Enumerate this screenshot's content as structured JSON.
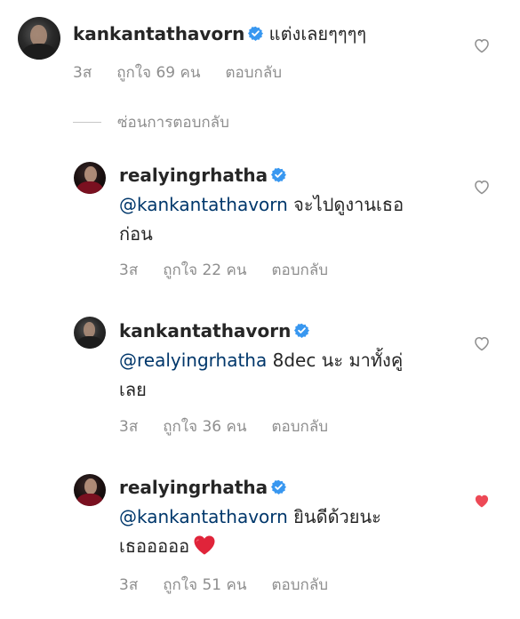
{
  "comments": [
    {
      "username": "kankantathavorn",
      "text": "แต่งเลยๆๆๆๆ",
      "time": "3ส",
      "likes": "ถูกใจ 69 คน",
      "reply": "ตอบกลับ",
      "liked": false
    },
    {
      "username": "realyingrhatha",
      "mention": "@kankantathavorn",
      "text_line1": " จะไปดูงานเธอ",
      "text_line2": "ก่อน",
      "time": "3ส",
      "likes": "ถูกใจ 22 คน",
      "reply": "ตอบกลับ",
      "liked": false
    },
    {
      "username": "kankantathavorn",
      "mention": "@realyingrhatha",
      "text_line1": " 8dec นะ มาทั้งคู่",
      "text_line2": "เลย",
      "time": "3ส",
      "likes": "ถูกใจ 36 คน",
      "reply": "ตอบกลับ",
      "liked": false
    },
    {
      "username": "realyingrhatha",
      "mention": "@kankantathavorn",
      "text_line1": " ยินดีด้วยนะ",
      "text_line2": "เธอออออ",
      "time": "3ส",
      "likes": "ถูกใจ 51 คน",
      "reply": "ตอบกลับ",
      "liked": true
    }
  ],
  "hide_replies": "ซ่อนการตอบกลับ",
  "colors": {
    "text": "#262626",
    "meta": "#8e8e8e",
    "mention": "#00376b",
    "verified": "#3897f0",
    "liked_heart": "#ed4956"
  },
  "icons": {
    "verified": "verified-badge-icon",
    "heart_outline": "heart-outline-icon",
    "heart_filled": "heart-filled-icon",
    "emoji": "red-heart-emoji"
  }
}
